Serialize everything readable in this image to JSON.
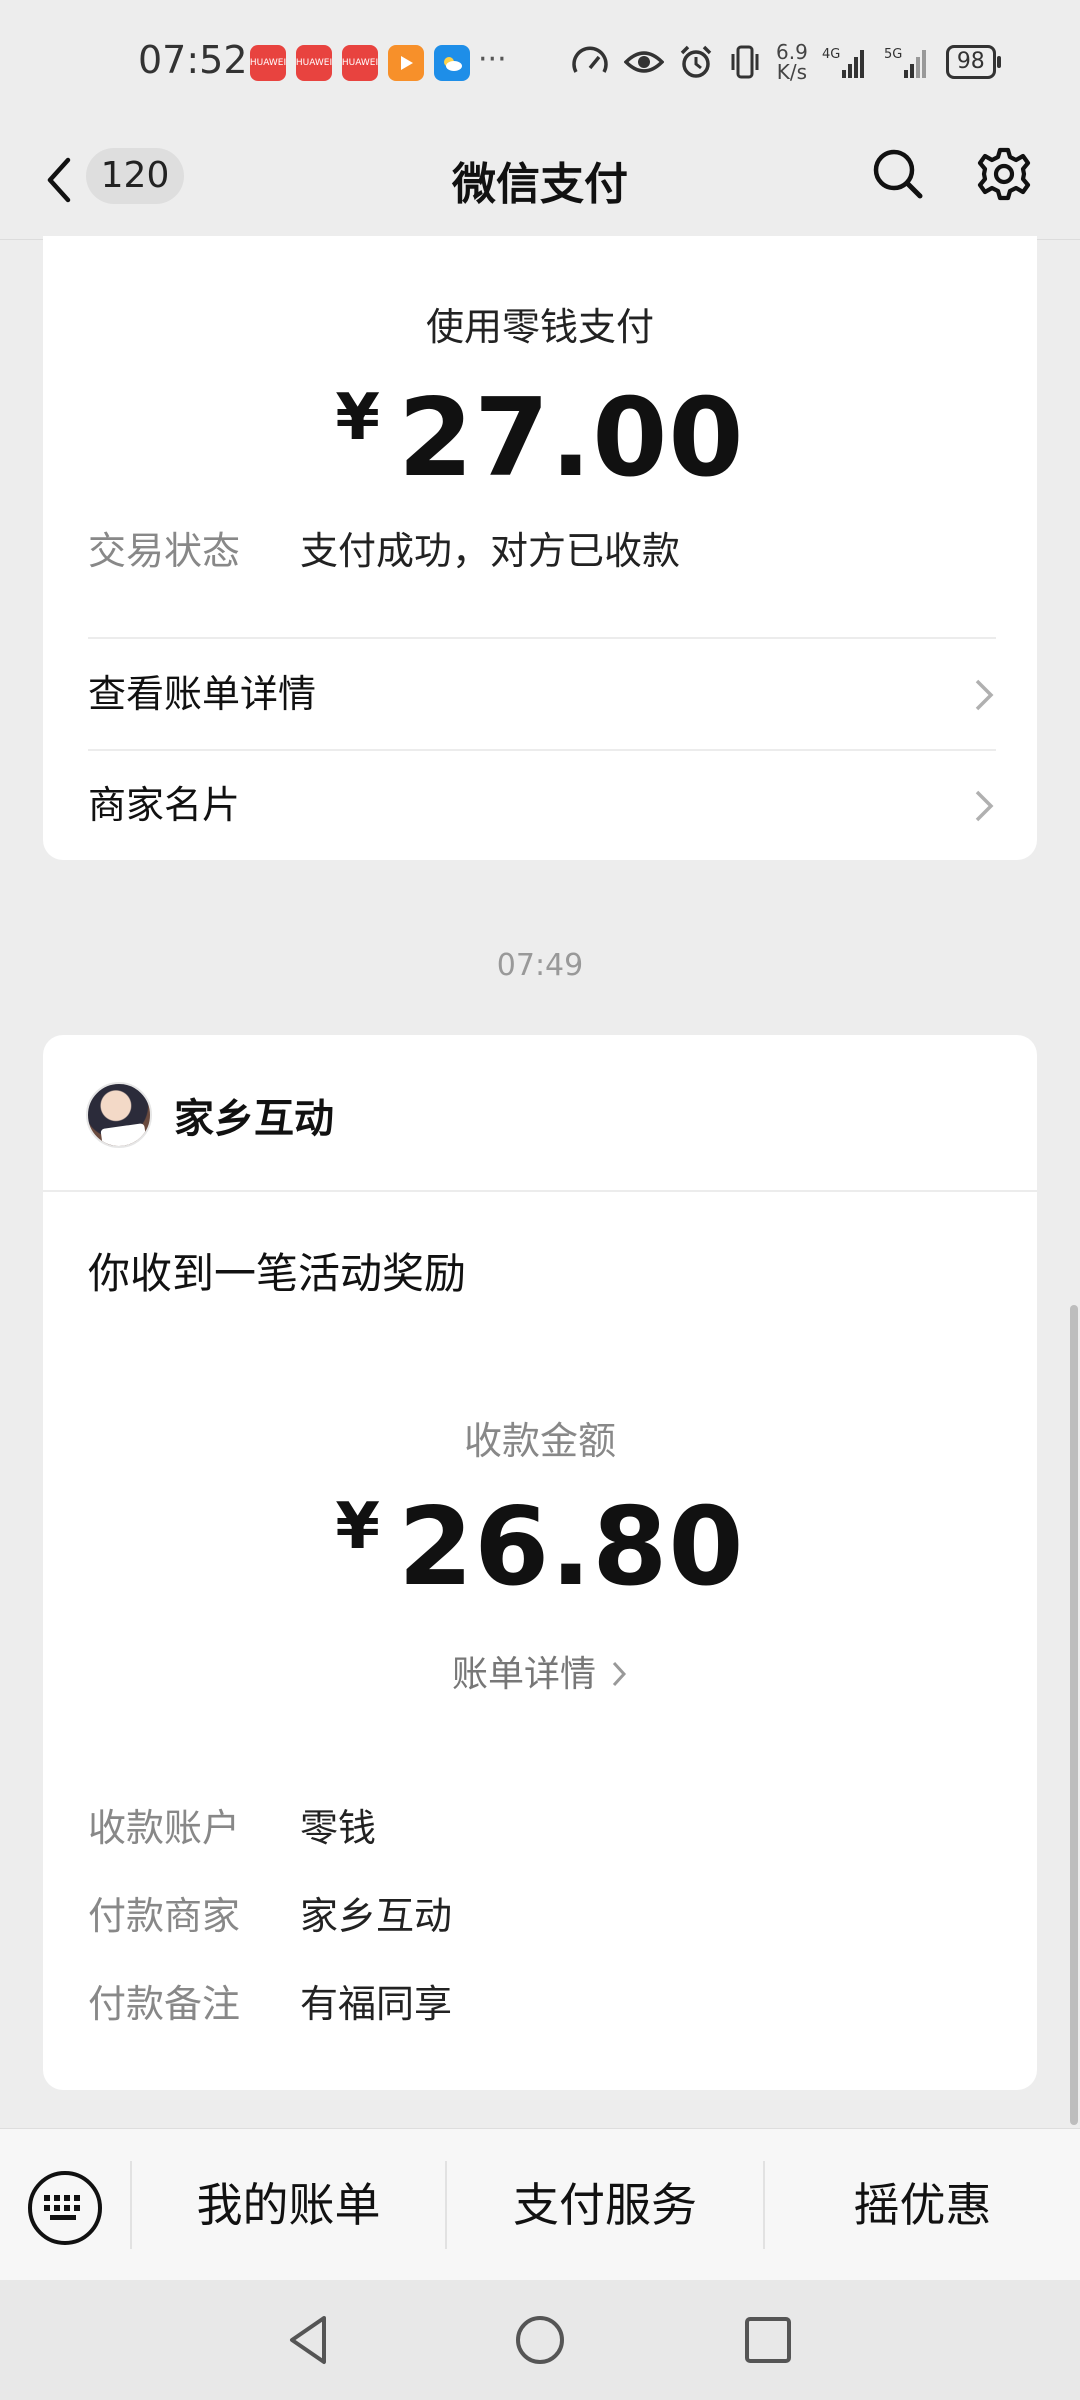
{
  "status_bar": {
    "time": "07:52",
    "app_icons": [
      "HUAWEI",
      "HUAWEI",
      "HUAWEI",
      "video",
      "weather"
    ],
    "more": "···",
    "speed_value": "6.9",
    "speed_unit": "K/s",
    "net1": "4G",
    "net2": "5G",
    "battery": "98"
  },
  "header": {
    "badge_count": "120",
    "title": "微信支付"
  },
  "payment_card": {
    "method": "使用零钱支付",
    "currency": "¥",
    "amount": "27.00",
    "status_label": "交易状态",
    "status_value": "支付成功，对方已收款",
    "link1": "查看账单详情",
    "link2": "商家名片"
  },
  "timestamp": "07:49",
  "reward_card": {
    "merchant": "家乡互动",
    "headline": "你收到一笔活动奖励",
    "amount_label": "收款金额",
    "currency": "¥",
    "amount": "26.80",
    "bill_link": "账单详情",
    "rows": [
      {
        "label": "收款账户",
        "value": "零钱"
      },
      {
        "label": "付款商家",
        "value": "家乡互动"
      },
      {
        "label": "付款备注",
        "value": "有福同享"
      }
    ]
  },
  "bottom_tabs": [
    "我的账单",
    "支付服务",
    "摇优惠"
  ],
  "colors": {
    "background": "#ededed",
    "card": "#ffffff",
    "label_gray": "#888888"
  }
}
